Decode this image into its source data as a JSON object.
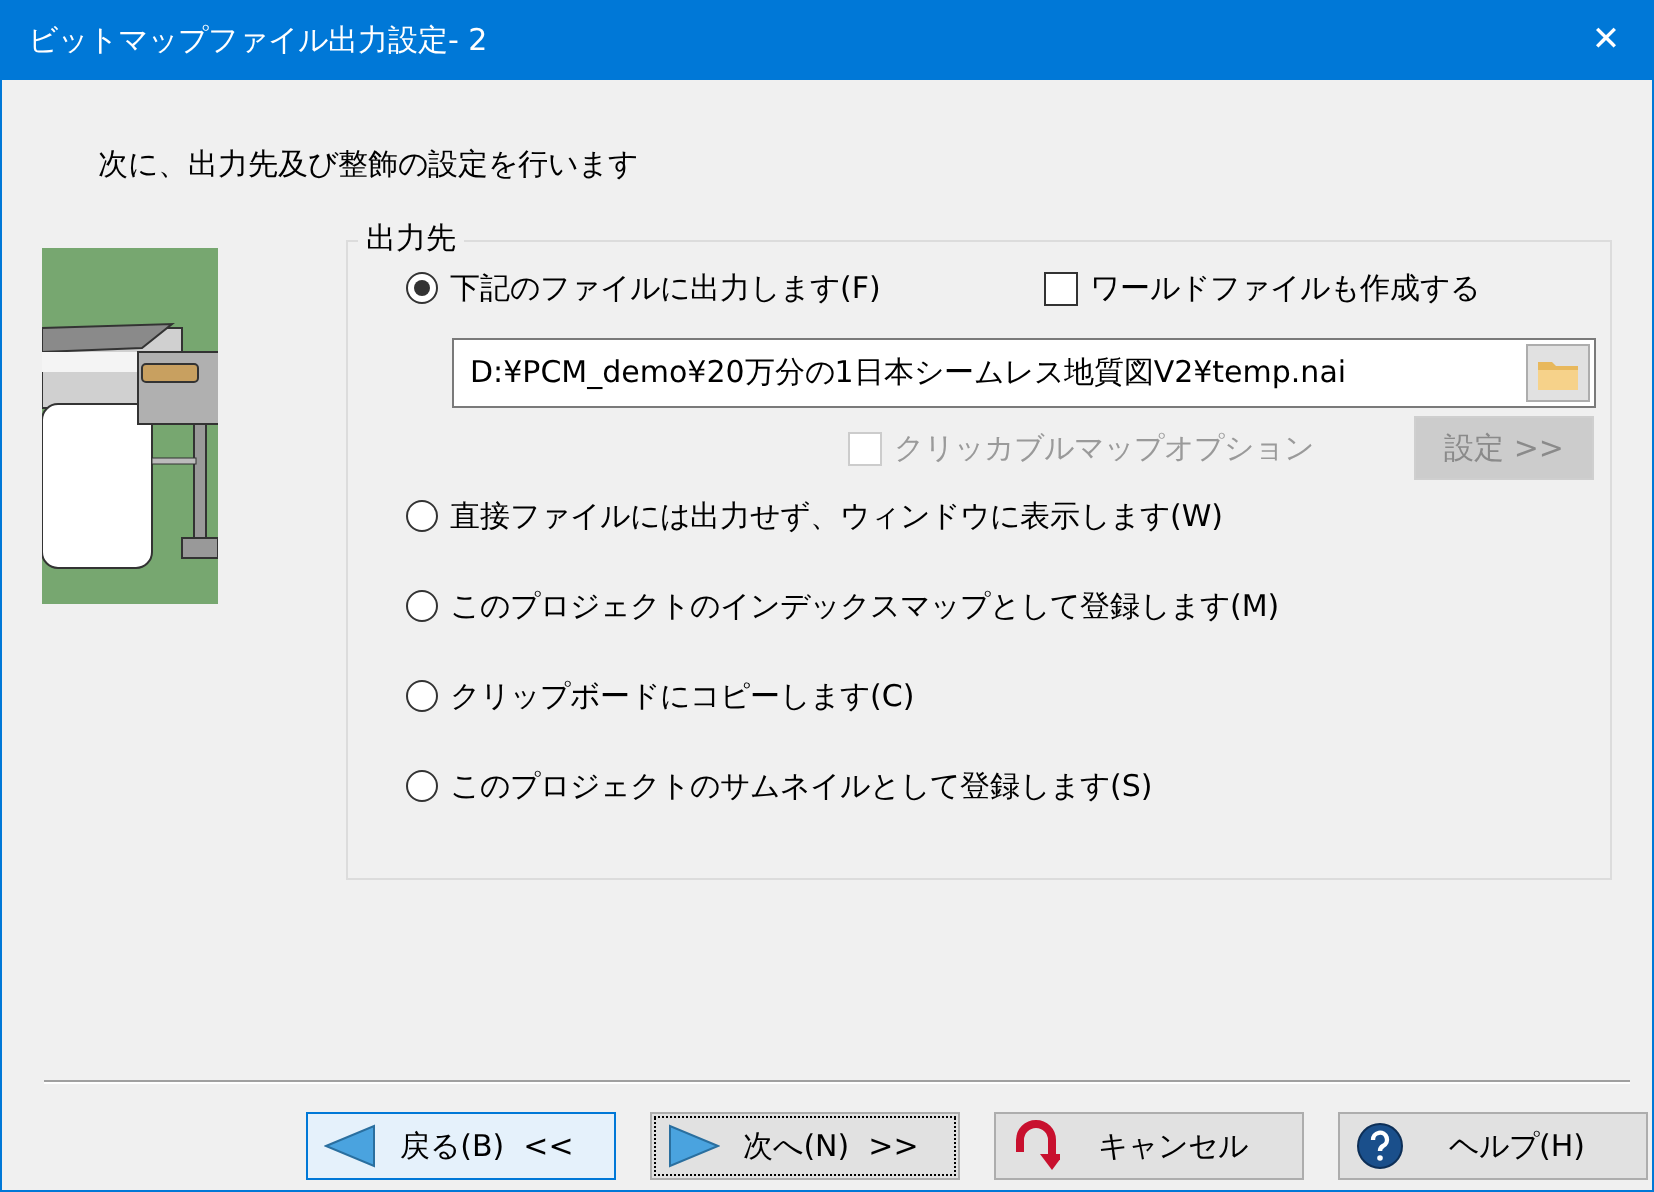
{
  "window": {
    "title": "ビットマップファイル出力設定- 2",
    "close_label": "✕"
  },
  "instruction": "次に、出力先及び整飾の設定を行います",
  "output_group": {
    "label": "出力先",
    "options": [
      {
        "label": "下記のファイルに出力します(F)",
        "selected": true,
        "kind": "file"
      },
      {
        "label": "直接ファイルには出力せず、ウィンドウに表示します(W)",
        "selected": false,
        "kind": "plain"
      },
      {
        "label": "このプロジェクトのインデックスマップとして登録します(M)",
        "selected": false,
        "kind": "plain"
      },
      {
        "label": "クリップボードにコピーします(C)",
        "selected": false,
        "kind": "plain"
      },
      {
        "label": "このプロジェクトのサムネイルとして登録します(S)",
        "selected": false,
        "kind": "plain"
      }
    ],
    "world_file": {
      "label": "ワールドファイルも作成する",
      "checked": false
    },
    "file_path": {
      "value": "D:¥PCM_demo¥20万分の1日本シームレス地質図V2¥temp.nai"
    },
    "clickable_map": {
      "label": "クリッカブルマップオプション",
      "checked": false,
      "disabled": true
    },
    "settings_button": {
      "label": "設定 >>",
      "disabled": true
    }
  },
  "buttons": [
    {
      "label": "戻る(B)  <<",
      "kind": "back",
      "selected": true
    },
    {
      "label": "次へ(N)  >>",
      "kind": "next",
      "selected": false
    },
    {
      "label": "キャンセル",
      "kind": "cancel",
      "selected": false
    },
    {
      "label": "ヘルプ(H)",
      "kind": "help",
      "selected": false
    }
  ]
}
